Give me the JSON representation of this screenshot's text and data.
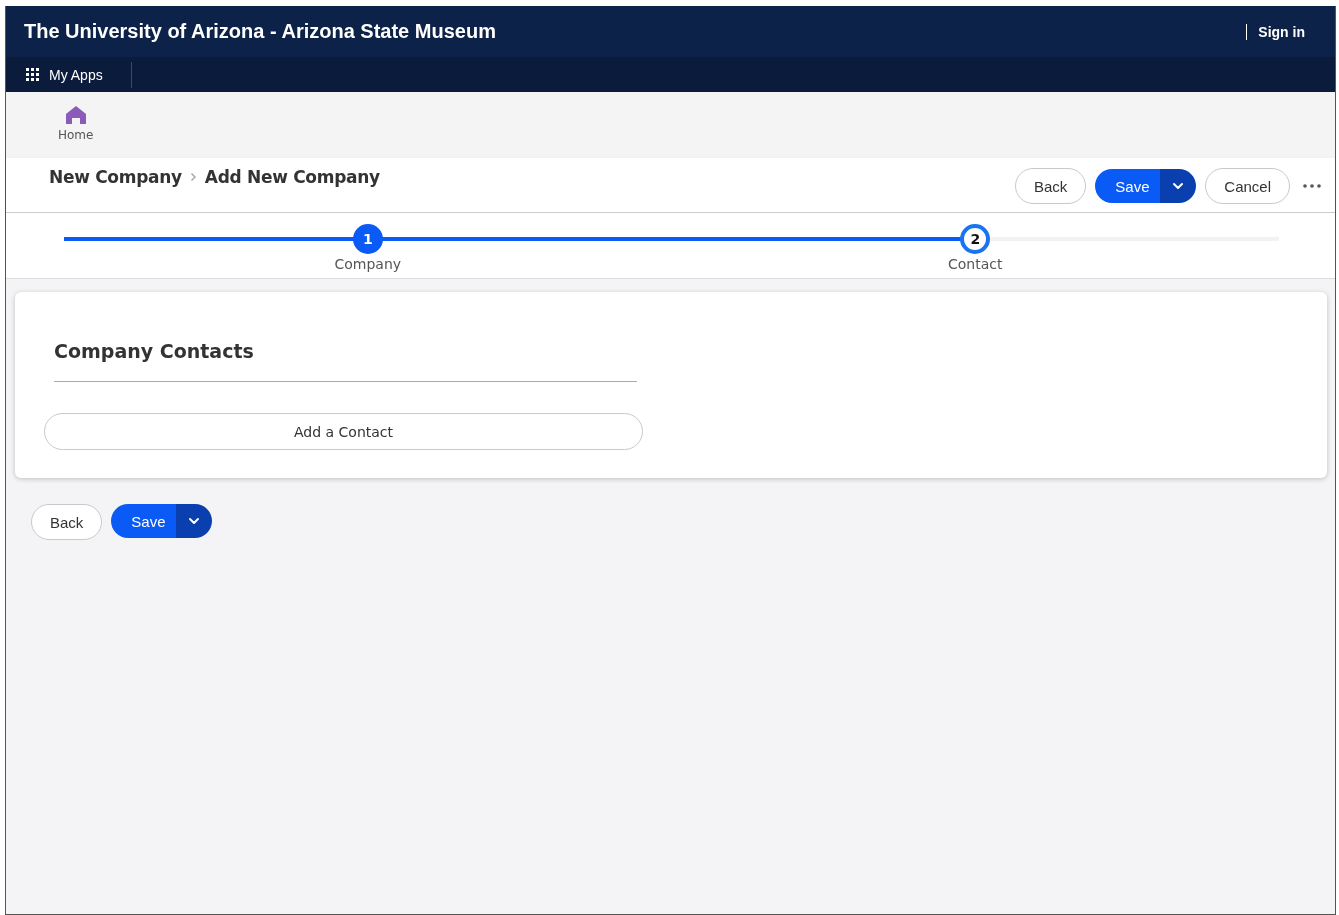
{
  "header": {
    "title": "The University of Arizona - Arizona State Museum",
    "sign_in": "Sign in"
  },
  "app_bar": {
    "apps_label": "My Apps"
  },
  "nav": [
    {
      "label": "Home"
    }
  ],
  "breadcrumb": [
    "New Company",
    "Add New Company"
  ],
  "top_actions": {
    "back": "Back",
    "save": "Save",
    "cancel": "Cancel"
  },
  "stepper": {
    "steps": [
      {
        "number": "1",
        "label": "Company",
        "selected": false
      },
      {
        "number": "2",
        "label": "Contact",
        "selected": true
      }
    ]
  },
  "card": {
    "title": "Company Contacts",
    "add_button": "Add a Contact"
  },
  "bottom_actions": {
    "back": "Back",
    "save": "Save"
  }
}
